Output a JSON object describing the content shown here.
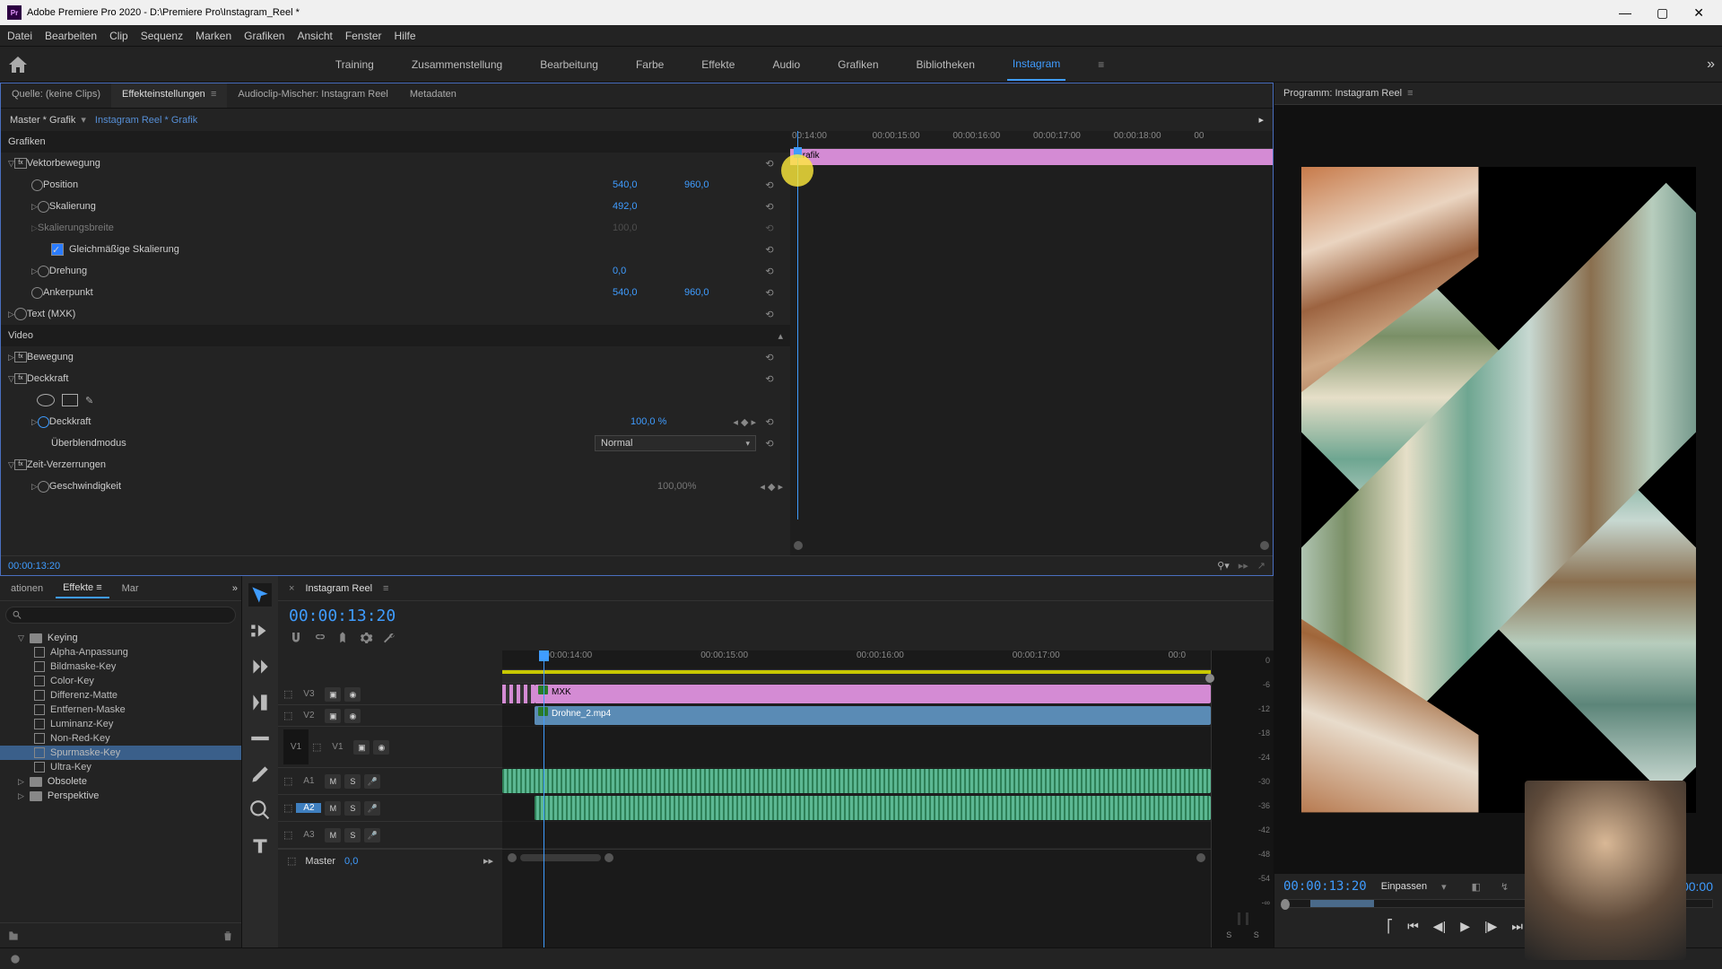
{
  "title": "Adobe Premiere Pro 2020 - D:\\Premiere Pro\\Instagram_Reel *",
  "menu": [
    "Datei",
    "Bearbeiten",
    "Clip",
    "Sequenz",
    "Marken",
    "Grafiken",
    "Ansicht",
    "Fenster",
    "Hilfe"
  ],
  "workspaces": [
    "Training",
    "Zusammenstellung",
    "Bearbeitung",
    "Farbe",
    "Effekte",
    "Audio",
    "Grafiken",
    "Bibliotheken",
    "Instagram"
  ],
  "workspace_active": "Instagram",
  "source_tabs": {
    "source": "Quelle: (keine Clips)",
    "effect": "Effekteinstellungen",
    "audio": "Audioclip-Mischer: Instagram Reel",
    "meta": "Metadaten"
  },
  "ec": {
    "master": "Master * Grafik",
    "seq": "Instagram Reel * Grafik",
    "group_grafiken": "Grafiken",
    "grp_vector": "Vektorbewegung",
    "position": "Position",
    "pos_x": "540,0",
    "pos_y": "960,0",
    "scale": "Skalierung",
    "scale_v": "492,0",
    "scalew": "Skalierungsbreite",
    "scalew_v": "100,0",
    "uniform": "Gleichmäßige Skalierung",
    "rotation": "Drehung",
    "rot_v": "0,0",
    "anchor": "Ankerpunkt",
    "anc_x": "540,0",
    "anc_y": "960,0",
    "text": "Text (MXK)",
    "group_video": "Video",
    "motion": "Bewegung",
    "opacity": "Deckkraft",
    "opacity_pct": "100,0 %",
    "blend": "Überblendmodus",
    "blend_v": "Normal",
    "time": "Zeit-Verzerrungen",
    "speed": "Geschwindigkeit",
    "speed_v": "100,00%",
    "tc_below": "00:00:13:20",
    "kf_clip": "Grafik"
  },
  "kf_ruler": [
    "00:14:00",
    "00:00:15:00",
    "00:00:16:00",
    "00:00:17:00",
    "00:00:18:00",
    "00"
  ],
  "effects_panel": {
    "tabs": [
      "ationen",
      "Effekte",
      "Mar"
    ],
    "search_placeholder": "",
    "keying": "Keying",
    "items": [
      "Alpha-Anpassung",
      "Bildmaske-Key",
      "Color-Key",
      "Differenz-Matte",
      "Entfernen-Maske",
      "Luminanz-Key",
      "Non-Red-Key",
      "Spurmaske-Key",
      "Ultra-Key"
    ],
    "selected": "Spurmaske-Key",
    "folders_after": [
      "Obsolete",
      "Perspektive"
    ]
  },
  "timeline": {
    "seq": "Instagram Reel",
    "tc": "00:00:13:20",
    "ruler": [
      "00:00:14:00",
      "00:00:15:00",
      "00:00:16:00",
      "00:00:17:00",
      "00:0"
    ],
    "tracks_v": [
      "V3",
      "V2",
      "V1"
    ],
    "tracks_a": [
      "A1",
      "A2",
      "A3"
    ],
    "clip_mxk": "MXK",
    "clip_drone": "Drohne_2.mp4",
    "master": "Master",
    "master_v": "0,0"
  },
  "audio_meter": [
    "0",
    "-6",
    "-12",
    "-18",
    "-24",
    "-30",
    "-36",
    "-42",
    "-48",
    "-54",
    "-∞"
  ],
  "program": {
    "title": "Programm: Instagram Reel",
    "tc_left": "00:00:13:20",
    "zoom": "Einpassen",
    "tc_right": "00:00"
  }
}
